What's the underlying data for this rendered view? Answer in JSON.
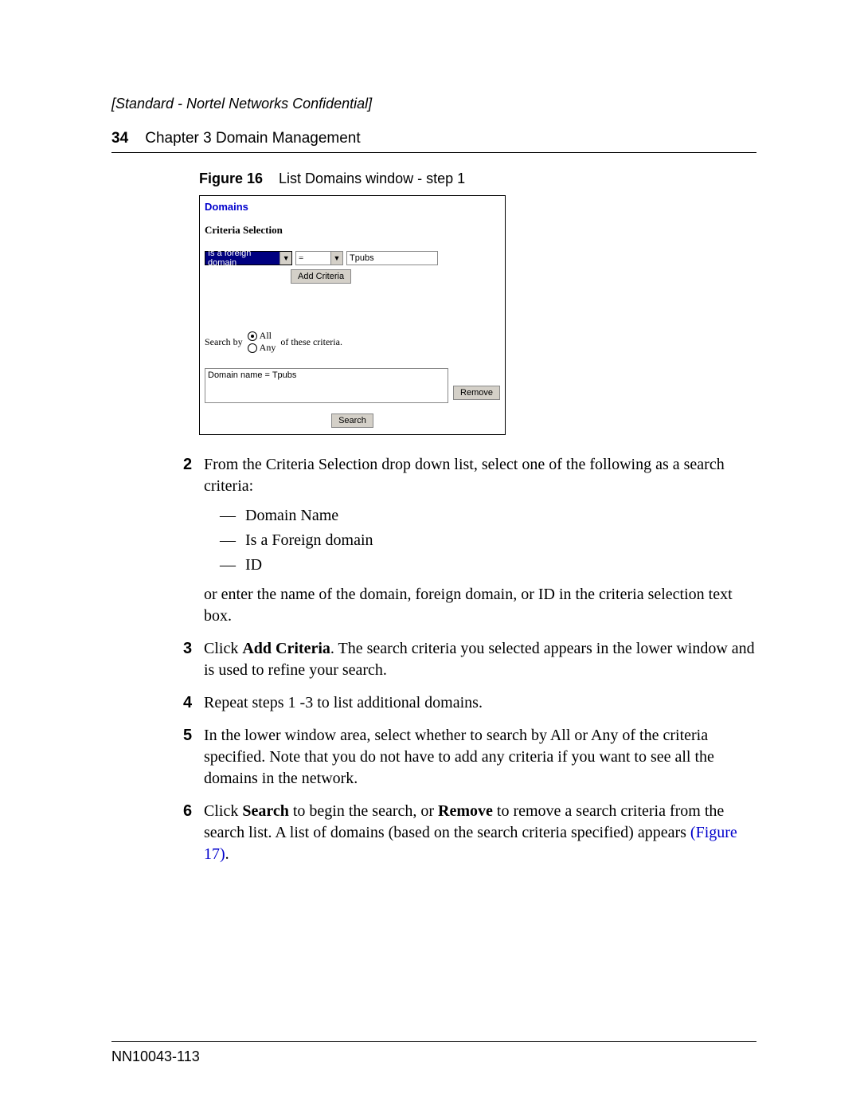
{
  "header": {
    "confidential": "[Standard - Nortel Networks Confidential]",
    "page_num": "34",
    "chapter_label": "Chapter 3  Domain Management"
  },
  "figure": {
    "label": "Figure 16",
    "caption": "List Domains window - step 1",
    "window": {
      "title": "Domains",
      "subtitle": "Criteria Selection",
      "select_field": "Is a foreign domain",
      "select_op": "=",
      "text_value": "Tpubs",
      "add_btn": "Add Criteria",
      "searchby_prefix": "Search by",
      "radio_all": "All",
      "radio_any": "Any",
      "searchby_suffix": "of these criteria.",
      "list_entry": "Domain name = Tpubs",
      "remove_btn": "Remove",
      "search_btn": "Search"
    }
  },
  "steps": {
    "s2": {
      "num": "2",
      "text_a": "From the Criteria Selection drop down list, select one of the following as a search criteria:",
      "opt1": "Domain Name",
      "opt2": "Is a Foreign domain",
      "opt3": "ID",
      "text_b": "or enter the name of the domain, foreign domain, or ID in the criteria selection text box."
    },
    "s3": {
      "num": "3",
      "pre": "Click ",
      "bold": "Add Criteria",
      "post": ". The search criteria you selected appears in the lower window and is used to refine your search."
    },
    "s4": {
      "num": "4",
      "text": "Repeat steps 1 -3 to list additional domains."
    },
    "s5": {
      "num": "5",
      "text": "In the lower window area, select whether to search by All or Any of the criteria specified. Note that you do not have to add any criteria if you want to see all the domains in the network."
    },
    "s6": {
      "num": "6",
      "pre": "Click ",
      "bold1": "Search",
      "mid1": " to begin the search, or ",
      "bold2": "Remove",
      "mid2": " to remove a search criteria from the search list. A list of domains (based on the search criteria specified) appears ",
      "link": "(Figure 17)",
      "post": "."
    }
  },
  "footer": {
    "doc_id": "NN10043-113"
  },
  "dash": "—"
}
